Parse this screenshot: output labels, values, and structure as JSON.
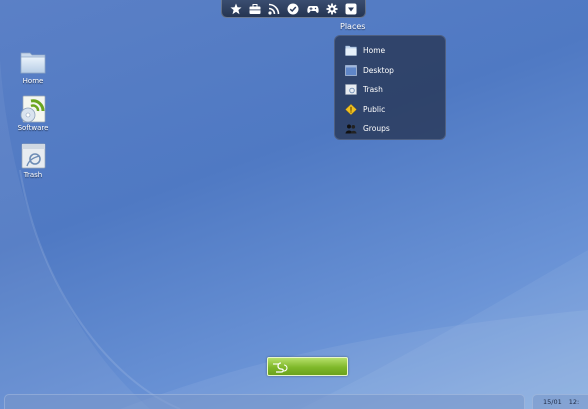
{
  "top_dock": {
    "icons": [
      "star-icon",
      "briefcase-icon",
      "rss-icon",
      "check-circle-icon",
      "gamepad-icon",
      "gear-icon",
      "menu-down-icon"
    ]
  },
  "desktop": {
    "icons": [
      {
        "label": "Home",
        "icon": "folder-icon"
      },
      {
        "label": "Software",
        "icon": "software-icon"
      },
      {
        "label": "Trash",
        "icon": "trash-icon"
      }
    ]
  },
  "places": {
    "title": "Places",
    "items": [
      {
        "label": "Home",
        "icon": "folder-icon"
      },
      {
        "label": "Desktop",
        "icon": "desktop-icon"
      },
      {
        "label": "Trash",
        "icon": "trash-icon"
      },
      {
        "label": "Public",
        "icon": "public-icon"
      },
      {
        "label": "Groups",
        "icon": "groups-icon"
      }
    ]
  },
  "taskbar": {
    "date": "15/01",
    "time": "12:"
  },
  "colors": {
    "background": "#5b80c6",
    "places_panel": "#263452",
    "dash_button": "#7fb82a"
  }
}
